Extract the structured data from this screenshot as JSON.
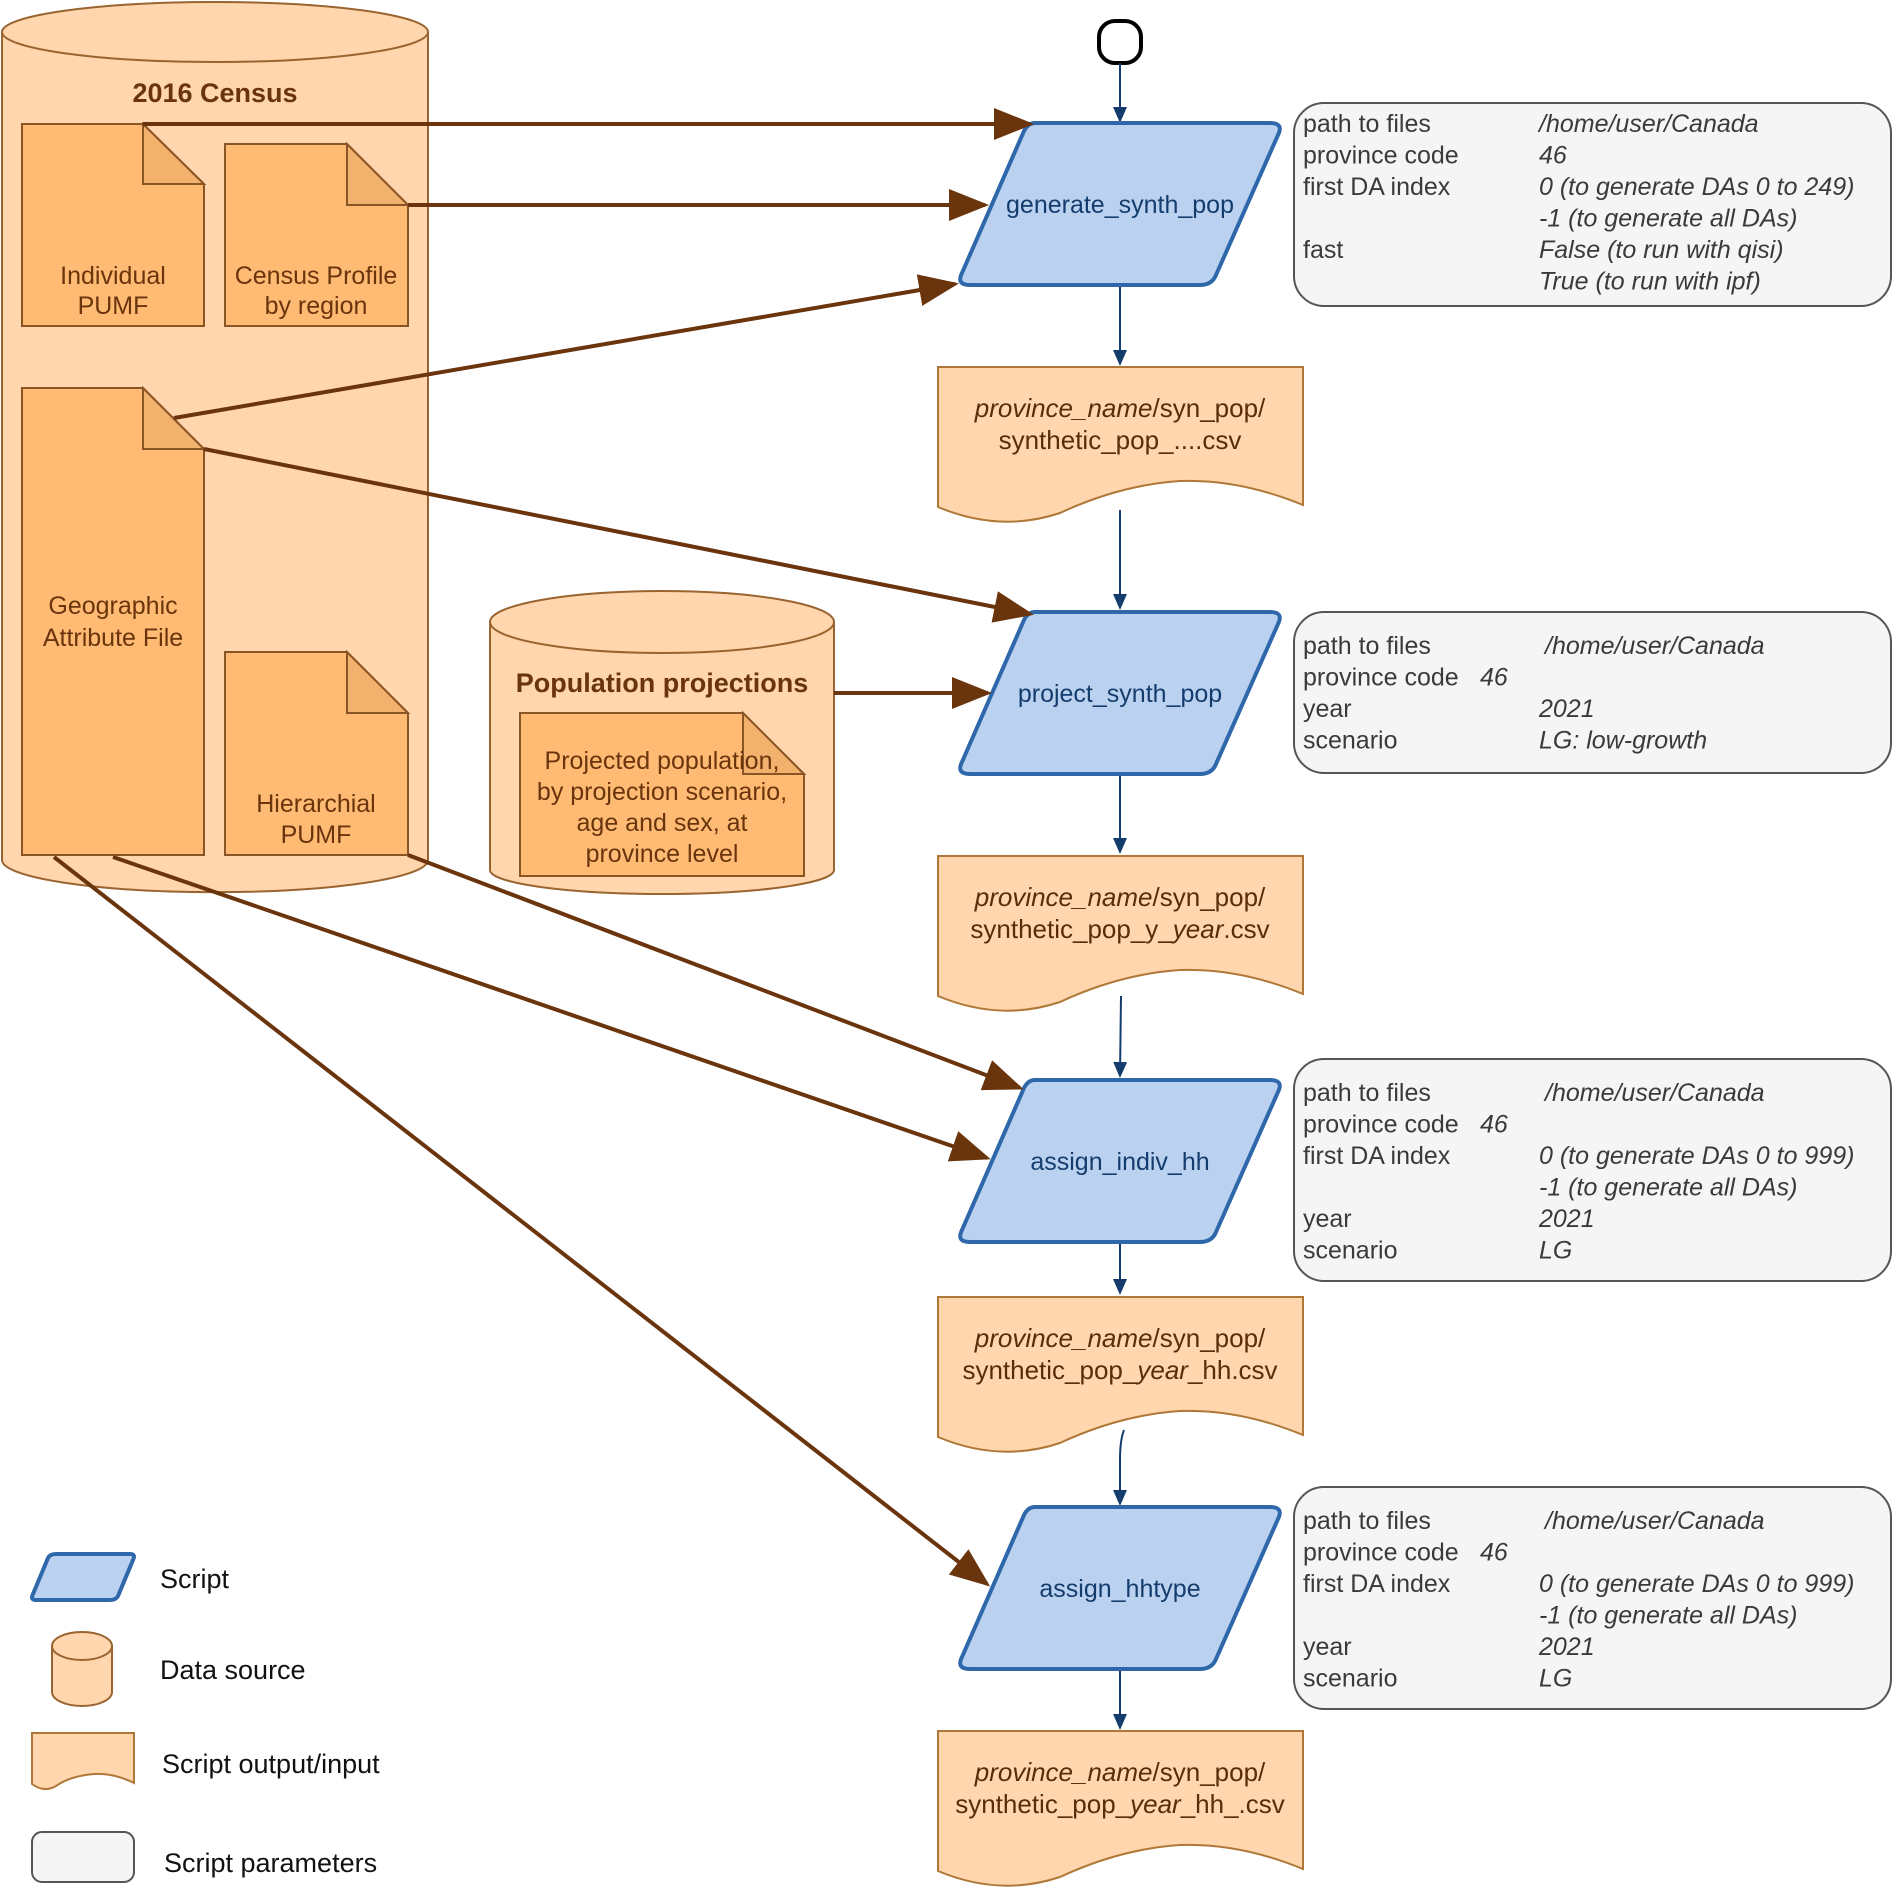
{
  "census": {
    "title": "2016 Census",
    "docs": {
      "individual_pumf": [
        "Individual",
        "PUMF"
      ],
      "census_profile": [
        "Census Profile",
        "by region"
      ],
      "geographic_attribute": [
        "Geographic",
        "Attribute File"
      ],
      "hierarchical_pumf": [
        "Hierarchial",
        "PUMF"
      ]
    }
  },
  "projections": {
    "title": "Population projections",
    "doc": [
      "Projected population,",
      "by projection scenario,",
      "age and sex, at",
      "province level"
    ]
  },
  "scripts": [
    {
      "name": "generate_synth_pop"
    },
    {
      "name": "project_synth_pop"
    },
    {
      "name": "assign_indiv_hh"
    },
    {
      "name": "assign_hhtype"
    }
  ],
  "outputs": [
    {
      "line1_italic": "province_name",
      "line1_rest": "/syn_pop/",
      "line2": [
        {
          "t": "synthetic_pop_....csv",
          "i": false
        }
      ]
    },
    {
      "line1_italic": "province_name",
      "line1_rest": "/syn_pop/",
      "line2": [
        {
          "t": "synthetic_pop_y_",
          "i": false
        },
        {
          "t": "year",
          "i": true
        },
        {
          "t": ".csv",
          "i": false
        }
      ]
    },
    {
      "line1_italic": "province_name",
      "line1_rest": "/syn_pop/",
      "line2": [
        {
          "t": "synthetic_pop_",
          "i": false
        },
        {
          "t": "year",
          "i": true
        },
        {
          "t": "_hh.csv",
          "i": false
        }
      ]
    },
    {
      "line1_italic": "province_name",
      "line1_rest": "/syn_pop/",
      "line2": [
        {
          "t": "synthetic_pop_",
          "i": false
        },
        {
          "t": "year",
          "i": true
        },
        {
          "t": "_hh_.csv",
          "i": false
        }
      ]
    }
  ],
  "params": [
    {
      "rows": [
        {
          "label": "path to files",
          "value": "/home/user/Canada"
        },
        {
          "label": "province code",
          "value": "46"
        },
        {
          "label": "first DA index",
          "value": "0 (to generate DAs 0 to 249)"
        },
        {
          "label": "",
          "value": "-1 (to generate all DAs)"
        },
        {
          "label": "fast",
          "value": "False (to run with qisi)"
        },
        {
          "label": "",
          "value": "True (to run with ipf)"
        }
      ]
    },
    {
      "rows": [
        {
          "label": "path to files",
          "value": "/home/user/Canada"
        },
        {
          "label": "province code",
          "value": "46",
          "inline": true
        },
        {
          "label": "year",
          "value": "2021"
        },
        {
          "label": "scenario",
          "value": "LG: low-growth"
        }
      ]
    },
    {
      "rows": [
        {
          "label": "path to files",
          "value": "/home/user/Canada"
        },
        {
          "label": "province code",
          "value": "46",
          "inline": true
        },
        {
          "label": "first DA index",
          "value": "0 (to generate DAs 0 to 999)"
        },
        {
          "label": "",
          "value": "-1 (to generate all DAs)"
        },
        {
          "label": "year",
          "value": "2021"
        },
        {
          "label": "scenario",
          "value": "LG"
        }
      ]
    },
    {
      "rows": [
        {
          "label": "path to files",
          "value": "/home/user/Canada"
        },
        {
          "label": "province code",
          "value": "46",
          "inline": true
        },
        {
          "label": "first DA index",
          "value": "0 (to generate DAs 0 to 999)"
        },
        {
          "label": "",
          "value": "-1 (to generate all DAs)"
        },
        {
          "label": "year",
          "value": "2021"
        },
        {
          "label": "scenario",
          "value": "LG"
        }
      ]
    }
  ],
  "legend": {
    "script": "Script",
    "data_source": "Data source",
    "output_input": "Script output/input",
    "parameters": "Script parameters"
  },
  "colors": {
    "script_fill": "#bad1ef",
    "script_stroke": "#2e67aa",
    "data_fill": "#ffd6ad",
    "doc_fill": "#ffba73",
    "param_fill": "#f5f5f5",
    "data_arrow": "#6a340c",
    "flow_arrow": "#143d6e"
  }
}
